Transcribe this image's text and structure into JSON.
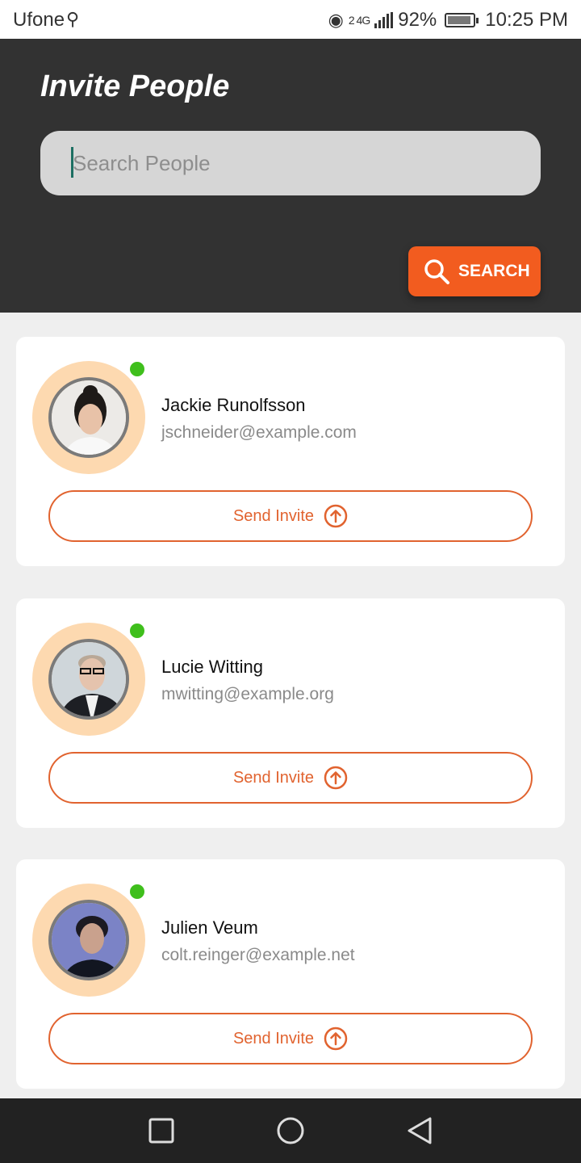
{
  "status_bar": {
    "carrier": "Ufone",
    "network_sup": "2 4G",
    "battery_percent": "92%",
    "time": "10:25 PM"
  },
  "header": {
    "title": "Invite People",
    "search_placeholder": "Search People",
    "search_value": "",
    "search_button_label": "SEARCH"
  },
  "people": [
    {
      "name": "Jackie Runolfsson",
      "email": "jschneider@example.com",
      "online": true,
      "invite_label": "Send Invite"
    },
    {
      "name": "Lucie Witting",
      "email": "mwitting@example.org",
      "online": true,
      "invite_label": "Send Invite"
    },
    {
      "name": "Julien Veum",
      "email": "colt.reinger@example.net",
      "online": true,
      "invite_label": "Send Invite"
    }
  ],
  "colors": {
    "accent": "#f25c1f",
    "header_bg": "#323232",
    "online": "#3fbf1c",
    "avatar_ring": "#fdd9b0"
  },
  "icons": {
    "search": "search-icon",
    "send": "arrow-up-circle-icon",
    "nav_recent": "square-icon",
    "nav_home": "circle-icon",
    "nav_back": "triangle-back-icon"
  }
}
